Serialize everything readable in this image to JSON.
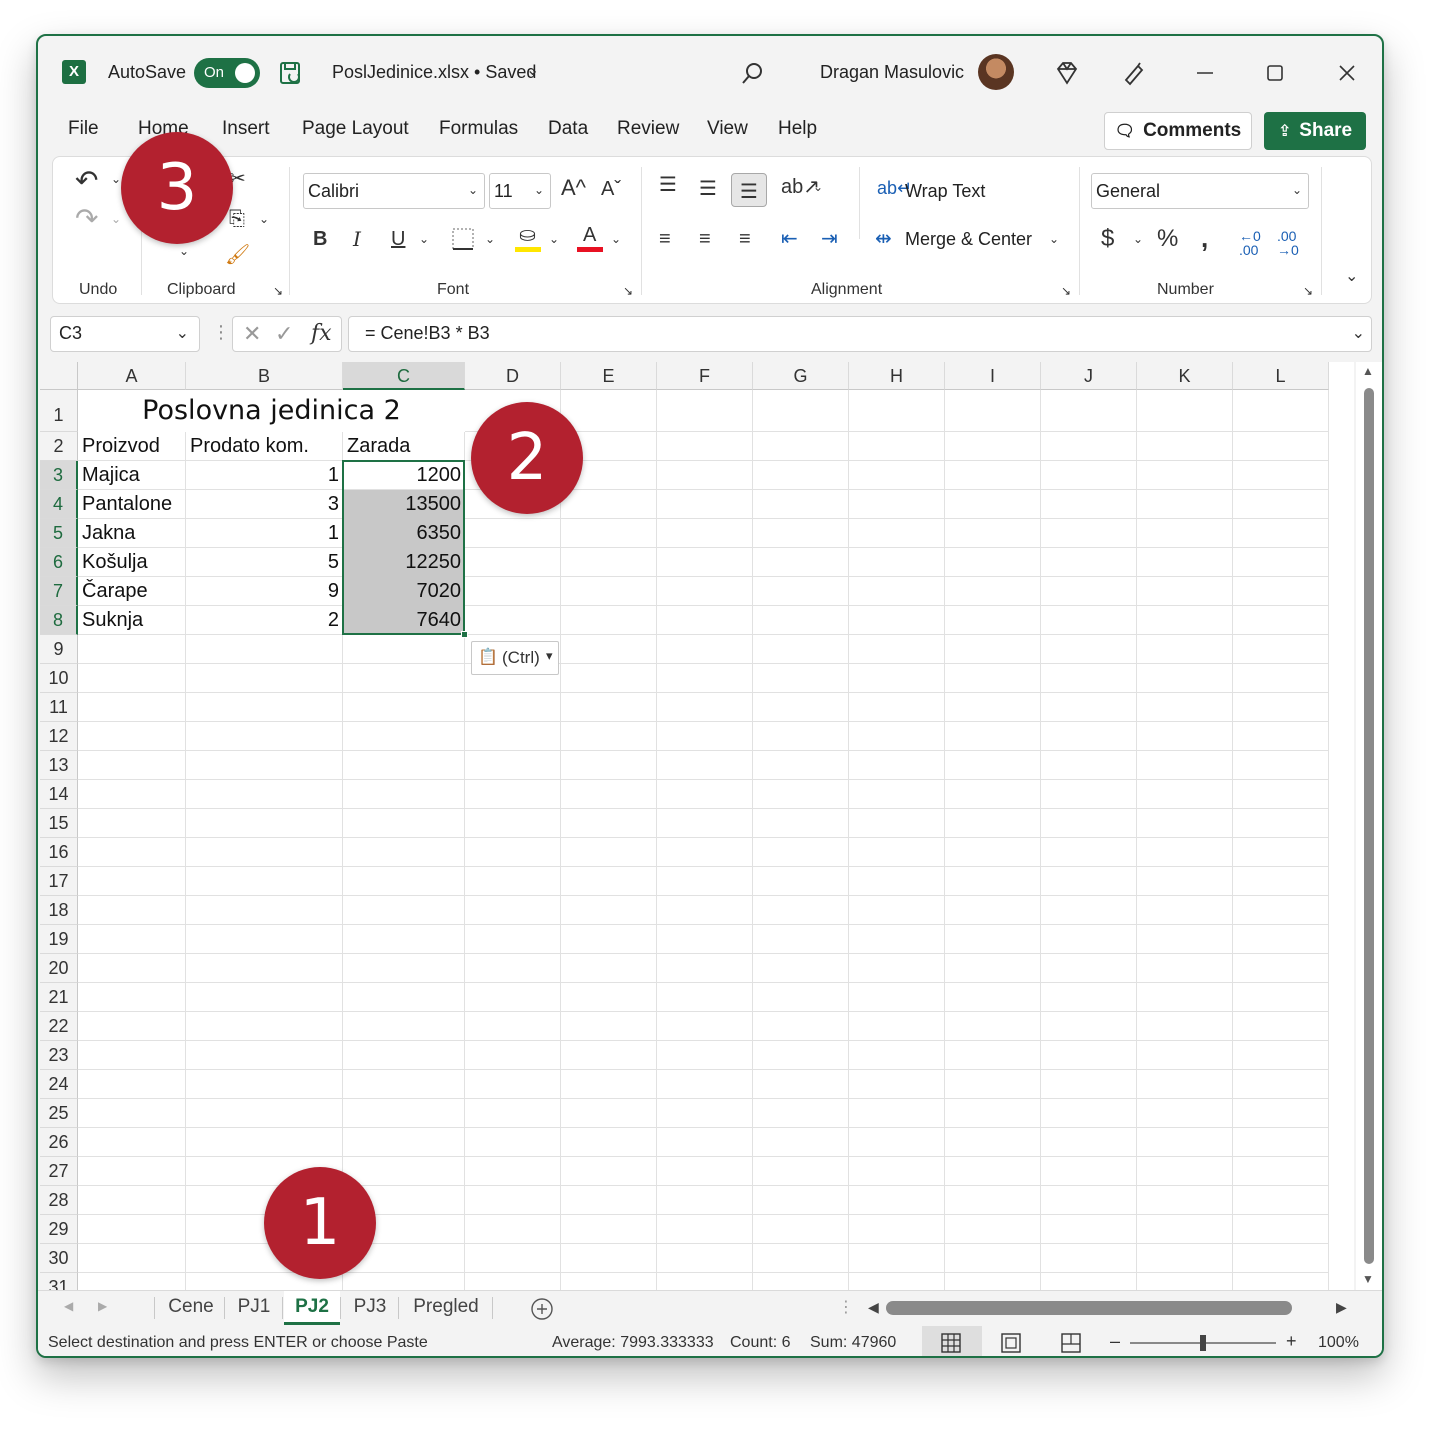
{
  "titlebar": {
    "app_icon": "excel-logo-icon",
    "autosave_label": "AutoSave",
    "autosave_state": "On",
    "filename": "PoslJedinice.xlsx • Saved",
    "username": "Dragan Masulovic"
  },
  "ribbon_tabs": [
    "File",
    "Home",
    "Insert",
    "Page Layout",
    "Formulas",
    "Data",
    "Review",
    "View",
    "Help"
  ],
  "active_ribbon_tab": "Home",
  "buttons": {
    "comments": "Comments",
    "share": "Share"
  },
  "ribbon": {
    "groups": {
      "undo": "Undo",
      "clipboard": "Clipboard",
      "font": "Font",
      "alignment": "Alignment",
      "number": "Number"
    },
    "font_name": "Calibri",
    "font_size": "11",
    "wrap_text": "Wrap Text",
    "merge_center": "Merge & Center",
    "number_format": "General",
    "font_size_up": "A^",
    "font_size_down": "Aˇ"
  },
  "formula_bar": {
    "name_box": "C3",
    "fx": "fx",
    "formula": "= Cene!B3 * B3"
  },
  "grid": {
    "columns": [
      "A",
      "B",
      "C",
      "D",
      "E",
      "F",
      "G",
      "H",
      "I",
      "J",
      "K",
      "L"
    ],
    "selected_column": "C",
    "rows": [
      "1",
      "2",
      "3",
      "4",
      "5",
      "6",
      "7",
      "8",
      "9",
      "10",
      "11",
      "12",
      "13",
      "14",
      "15",
      "16",
      "17",
      "18",
      "19",
      "20",
      "21",
      "22",
      "23",
      "24",
      "25",
      "26",
      "27",
      "28",
      "29",
      "30",
      "31"
    ],
    "title": "Poslovna jedinica 2",
    "headers": [
      "Proizvod",
      "Prodato kom.",
      "Zarada"
    ],
    "data": [
      [
        "Majica",
        "1",
        "1200"
      ],
      [
        "Pantalone",
        "3",
        "13500"
      ],
      [
        "Jakna",
        "1",
        "6350"
      ],
      [
        "Košulja",
        "5",
        "12250"
      ],
      [
        "Čarape",
        "9",
        "7020"
      ],
      [
        "Suknja",
        "2",
        "7640"
      ]
    ],
    "paste_options": "(Ctrl)"
  },
  "sheet_tabs": [
    "Cene",
    "PJ1",
    "PJ2",
    "PJ3",
    "Pregled"
  ],
  "active_sheet": "PJ2",
  "status": {
    "message": "Select destination and press ENTER or choose Paste",
    "average": "Average: 7993.333333",
    "count": "Count: 6",
    "sum": "Sum: 47960",
    "zoom": "100%",
    "zoom_minus": "–",
    "zoom_plus": "+"
  },
  "callouts": [
    "1",
    "2",
    "3"
  ],
  "colors": {
    "accent": "#1e7145",
    "callout": "#b3212f",
    "selection": "#c8c8c8"
  }
}
